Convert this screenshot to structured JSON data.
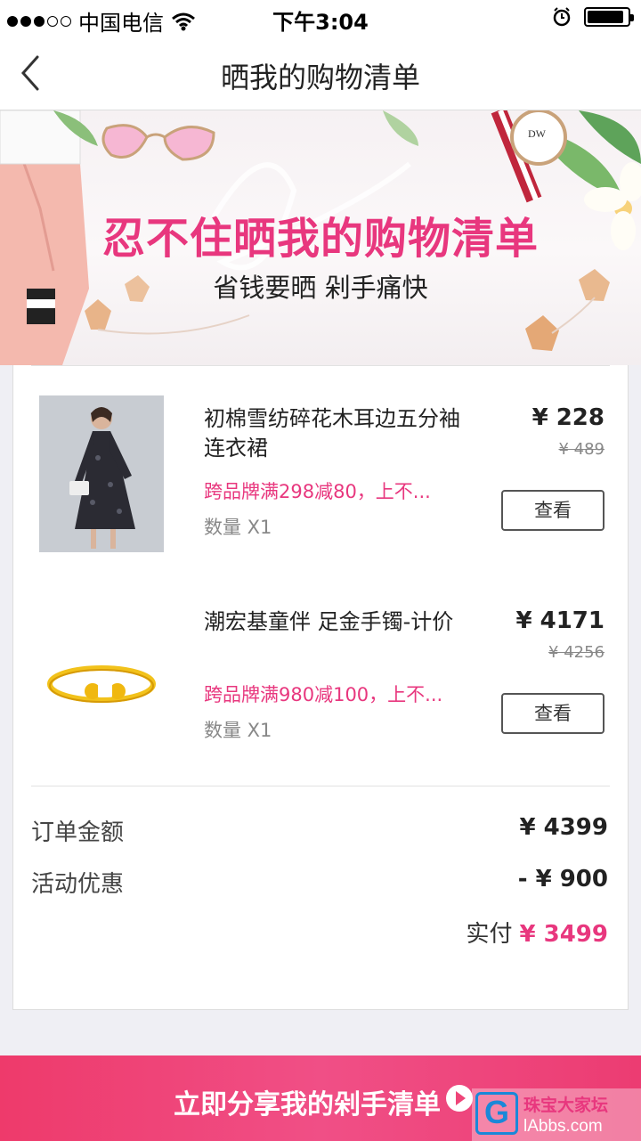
{
  "status_bar": {
    "carrier": "中国电信",
    "time": "下午3:04"
  },
  "nav": {
    "title": "晒我的购物清单"
  },
  "banner": {
    "headline": "忍不住晒我的购物清单",
    "subline": "省钱要晒 剁手痛快"
  },
  "items": [
    {
      "name": "初棉雪纺碎花木耳边五分袖连衣裙",
      "promo": "跨品牌满298减80，上不...",
      "quantity": "数量 X1",
      "price": "¥ 228",
      "original_price": "¥ 489",
      "view_label": "查看"
    },
    {
      "name": "潮宏基童伴 足金手镯-计价",
      "promo": "跨品牌满980减100，上不...",
      "quantity": "数量 X1",
      "price": "¥ 4171",
      "original_price": "¥ 4256",
      "view_label": "查看"
    }
  ],
  "summary": {
    "order_total_label": "订单金额",
    "order_total_value": "¥ 4399",
    "discount_label": "活动优惠",
    "discount_value": "- ¥ 900",
    "paid_label": "实付",
    "paid_value": "¥ 3499"
  },
  "share": {
    "label": "立即分享我的剁手清单"
  },
  "watermark": {
    "logo_letter": "G",
    "site_name": "珠宝大家坛",
    "site_url": "lAbbs.com"
  },
  "colors": {
    "accent": "#e8377e",
    "share_bar": "#ef4579"
  }
}
